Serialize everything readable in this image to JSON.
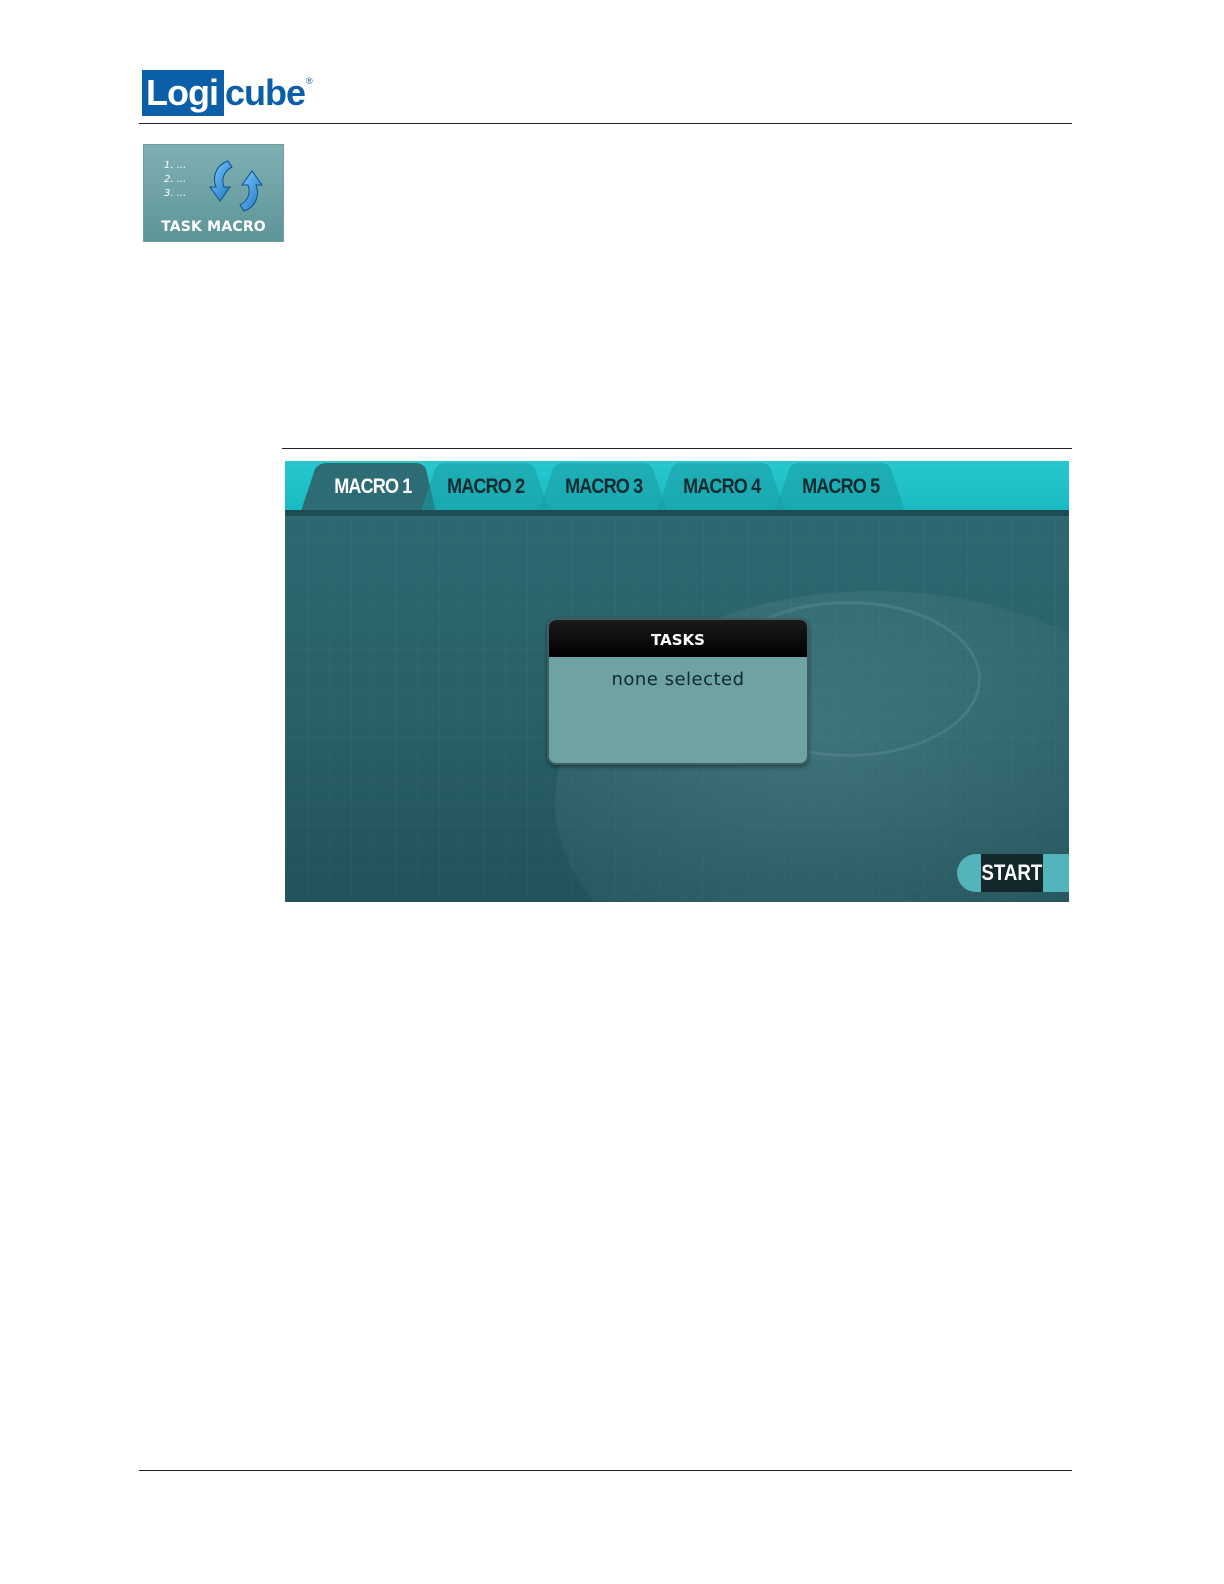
{
  "header": {
    "logo_text_block": "Logi",
    "logo_text_tail": "cube",
    "logo_reg": "®"
  },
  "macro_icon": {
    "list_lines": [
      "1. ...",
      "2. ...",
      "3. ..."
    ],
    "label": "TASK MACRO",
    "icon": "refresh-arrows-icon"
  },
  "screen": {
    "tabs": [
      {
        "label": "MACRO 1",
        "active": true
      },
      {
        "label": "MACRO 2",
        "active": false
      },
      {
        "label": "MACRO 3",
        "active": false
      },
      {
        "label": "MACRO 4",
        "active": false
      },
      {
        "label": "MACRO 5",
        "active": false
      }
    ],
    "tasks_title": "TASKS",
    "tasks_value": "none selected",
    "start_label": "START"
  },
  "colors": {
    "brand": "#0b5ea8",
    "tabbar": "#1fc2c8",
    "screen_bg": "#2e6a72",
    "tasks_box": "#6fa3a3"
  }
}
